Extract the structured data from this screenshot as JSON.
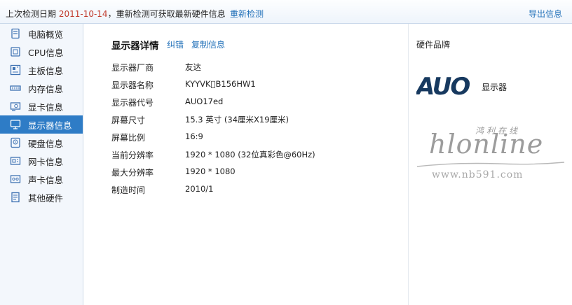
{
  "topbar": {
    "prefix": "上次检测日期 ",
    "date": "2011-10-14",
    "suffix": "，重新检测可获取最新硬件信息",
    "recheck_label": "重新检测",
    "export_label": "导出信息"
  },
  "sidebar": {
    "items": [
      {
        "label": "电脑概览",
        "icon": "computer-overview-icon"
      },
      {
        "label": "CPU信息",
        "icon": "cpu-icon"
      },
      {
        "label": "主板信息",
        "icon": "motherboard-icon"
      },
      {
        "label": "内存信息",
        "icon": "memory-icon"
      },
      {
        "label": "显卡信息",
        "icon": "graphics-card-icon"
      },
      {
        "label": "显示器信息",
        "icon": "monitor-icon",
        "active": true
      },
      {
        "label": "硬盘信息",
        "icon": "hard-disk-icon"
      },
      {
        "label": "网卡信息",
        "icon": "network-card-icon"
      },
      {
        "label": "声卡信息",
        "icon": "sound-card-icon"
      },
      {
        "label": "其他硬件",
        "icon": "other-hardware-icon"
      }
    ]
  },
  "detail": {
    "title": "显示器详情",
    "correct_label": "纠错",
    "copy_label": "复制信息",
    "rows": [
      {
        "key": "显示器厂商",
        "value": "友达"
      },
      {
        "key": "显示器名称",
        "value": "KYYVK\u0000B156HW1"
      },
      {
        "key": "显示器代号",
        "value": "AUO17ed"
      },
      {
        "key": "屏幕尺寸",
        "value": "15.3 英寸 (34厘米X19厘米)"
      },
      {
        "key": "屏幕比例",
        "value": "16:9"
      },
      {
        "key": "当前分辨率",
        "value": "1920 * 1080 (32位真彩色@60Hz)"
      },
      {
        "key": "最大分辨率",
        "value": "1920 * 1080"
      },
      {
        "key": "制造时间",
        "value": "2010/1"
      }
    ]
  },
  "brand": {
    "title": "硬件品牌",
    "logo_text": "AUO",
    "type_label": "显示器",
    "logo_color": "#17395f"
  },
  "watermark": {
    "cn_text": "鸿利在线",
    "big_text": "hlonline",
    "url": "www.nb591.com"
  },
  "colors": {
    "accent": "#2e7cc6",
    "link": "#1f6fb8",
    "date": "#c0392b"
  }
}
